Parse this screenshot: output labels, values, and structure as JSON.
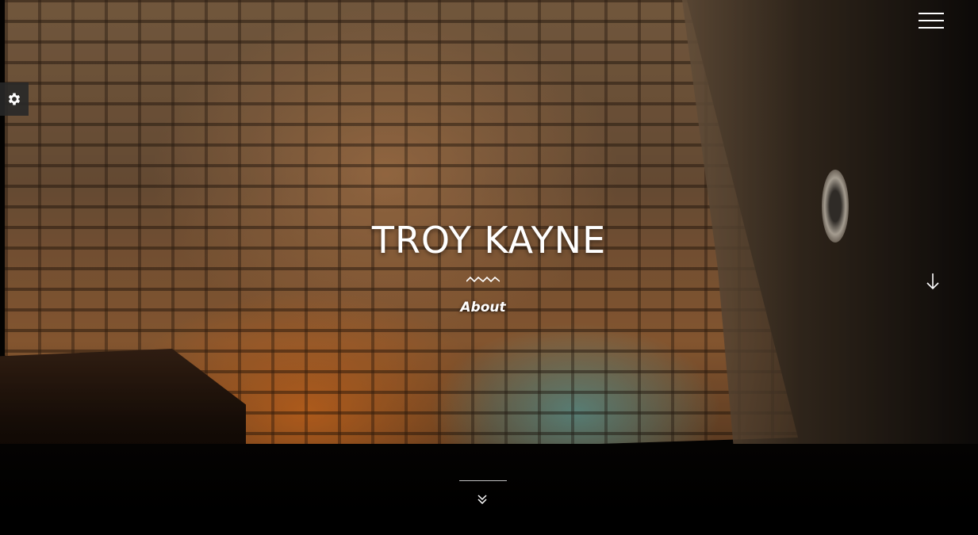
{
  "header": {
    "menu_icon": "hamburger-menu-icon",
    "settings_icon": "gear-icon"
  },
  "hero": {
    "title": "TROY KAYNE",
    "divider_icon": "wave-icon",
    "link_label": "About",
    "side_arrow_icon": "arrow-down-icon",
    "scroll_icon": "double-chevron-down-icon"
  },
  "colors": {
    "text": "#ffffff",
    "settings_bg": "#282828"
  }
}
